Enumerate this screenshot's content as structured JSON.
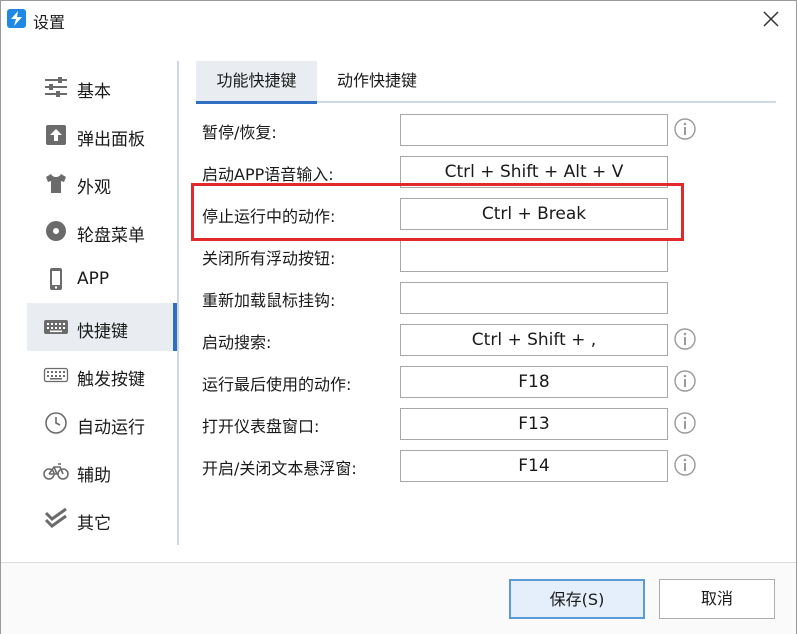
{
  "window": {
    "title": "设置",
    "close_icon": "close-icon"
  },
  "sidebar": {
    "items": [
      {
        "label": "基本",
        "icon": "sliders-icon"
      },
      {
        "label": "弹出面板",
        "icon": "upload-icon"
      },
      {
        "label": "外观",
        "icon": "shirt-icon"
      },
      {
        "label": "轮盘菜单",
        "icon": "disc-icon"
      },
      {
        "label": "APP",
        "icon": "phone-icon"
      },
      {
        "label": "快捷键",
        "icon": "keyboard-icon",
        "active": true
      },
      {
        "label": "触发按键",
        "icon": "keyboard-outline-icon"
      },
      {
        "label": "自动运行",
        "icon": "clock-icon"
      },
      {
        "label": "辅助",
        "icon": "bicycle-icon"
      },
      {
        "label": "其它",
        "icon": "check-stack-icon"
      }
    ]
  },
  "tabs": [
    {
      "label": "功能快捷键",
      "active": true
    },
    {
      "label": "动作快捷键",
      "active": false
    }
  ],
  "shortcuts": [
    {
      "label": "暂停/恢复:",
      "value": "",
      "info": true
    },
    {
      "label": "启动APP语音输入:",
      "value": "Ctrl + Shift + Alt + V",
      "info": false
    },
    {
      "label": "停止运行中的动作:",
      "value": "Ctrl + Break",
      "info": false
    },
    {
      "label": "关闭所有浮动按钮:",
      "value": "",
      "info": false
    },
    {
      "label": "重新加载鼠标挂钩:",
      "value": "",
      "info": false
    },
    {
      "label": "启动搜索:",
      "value": "Ctrl + Shift + ,",
      "info": true
    },
    {
      "label": "运行最后使用的动作:",
      "value": "F18",
      "info": true
    },
    {
      "label": "打开仪表盘窗口:",
      "value": "F13",
      "info": true
    },
    {
      "label": "开启/关闭文本悬浮窗:",
      "value": "F14",
      "info": true
    }
  ],
  "footer": {
    "save_label": "保存(S)",
    "cancel_label": "取消"
  },
  "colors": {
    "accent": "#2f6fc1",
    "highlight": "#e32a2a",
    "brand": "#1e88e5"
  }
}
